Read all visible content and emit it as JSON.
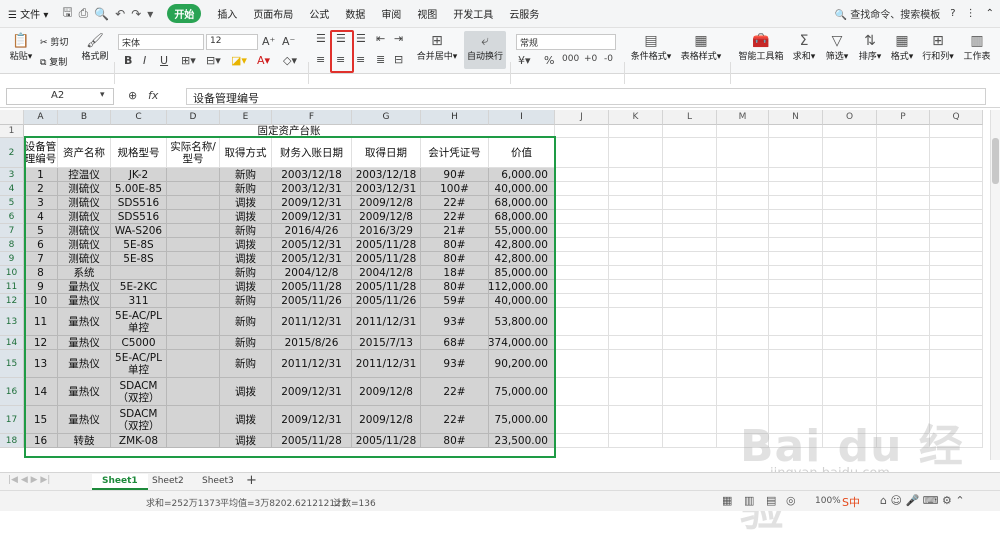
{
  "menubar": {
    "file": "文件",
    "tabs": [
      "开始",
      "插入",
      "页面布局",
      "公式",
      "数据",
      "审阅",
      "视图",
      "开发工具",
      "云服务"
    ],
    "active_tab": "开始",
    "search": "查找命令、搜索模板"
  },
  "ribbon": {
    "paste": "粘贴",
    "cut": "剪切",
    "copy": "复制",
    "format_painter": "格式刷",
    "font_name": "宋体",
    "font_size": "12",
    "merge_center": "合并居中",
    "wrap_text": "自动换行",
    "number_format": "常规",
    "conditional_format": "条件格式",
    "table_style": "表格样式",
    "smart_toolbox": "智能工具箱",
    "sum": "求和",
    "filter": "筛选",
    "sort": "排序",
    "format": "格式",
    "row_col": "行和列",
    "worksheet": "工作表"
  },
  "formula_bar": {
    "name_box": "A2",
    "fx": "fx",
    "content": "设备管理编号"
  },
  "columns": [
    "A",
    "B",
    "C",
    "D",
    "E",
    "F",
    "G",
    "H",
    "I",
    "J",
    "K",
    "L",
    "M",
    "N",
    "O",
    "P",
    "Q"
  ],
  "sheet": {
    "title": "固定资产台账",
    "headers": [
      "设备管理编号",
      "资产名称",
      "规格型号",
      "实际名称/型号",
      "取得方式",
      "财务入账日期",
      "取得日期",
      "会计凭证号",
      "价值"
    ],
    "rows": [
      [
        "1",
        "控温仪",
        "JK-2",
        "",
        "新购",
        "2003/12/18",
        "2003/12/18",
        "90#",
        "6,000.00"
      ],
      [
        "2",
        "测硫仪",
        "5.00E-85",
        "",
        "新购",
        "2003/12/31",
        "2003/12/31",
        "100#",
        "40,000.00"
      ],
      [
        "3",
        "测硫仪",
        "SDS516",
        "",
        "调拨",
        "2009/12/31",
        "2009/12/8",
        "22#",
        "68,000.00"
      ],
      [
        "4",
        "测硫仪",
        "SDS516",
        "",
        "调拨",
        "2009/12/31",
        "2009/12/8",
        "22#",
        "68,000.00"
      ],
      [
        "5",
        "测硫仪",
        "WA-S206",
        "",
        "新购",
        "2016/4/26",
        "2016/3/29",
        "21#",
        "55,000.00"
      ],
      [
        "6",
        "测硫仪",
        "5E-8S",
        "",
        "调拨",
        "2005/12/31",
        "2005/11/28",
        "80#",
        "42,800.00"
      ],
      [
        "7",
        "测硫仪",
        "5E-8S",
        "",
        "调拨",
        "2005/12/31",
        "2005/11/28",
        "80#",
        "42,800.00"
      ],
      [
        "8",
        "系统",
        "",
        "",
        "新购",
        "2004/12/8",
        "2004/12/8",
        "18#",
        "85,000.00"
      ],
      [
        "9",
        "量热仪",
        "5E-2KC",
        "",
        "调拨",
        "2005/11/28",
        "2005/11/28",
        "80#",
        "112,000.00"
      ],
      [
        "10",
        "量热仪",
        "311",
        "",
        "新购",
        "2005/11/26",
        "2005/11/26",
        "59#",
        "40,000.00"
      ],
      [
        "11",
        "量热仪",
        "5E-AC/PL单控",
        "",
        "新购",
        "2011/12/31",
        "2011/12/31",
        "93#",
        "53,800.00"
      ],
      [
        "12",
        "量热仪",
        "C5000",
        "",
        "新购",
        "2015/8/26",
        "2015/7/13",
        "68#",
        "374,000.00"
      ],
      [
        "13",
        "量热仪",
        "5E-AC/PL单控",
        "",
        "新购",
        "2011/12/31",
        "2011/12/31",
        "93#",
        "90,200.00"
      ],
      [
        "14",
        "量热仪",
        "SDACM（双控）",
        "",
        "调拨",
        "2009/12/31",
        "2009/12/8",
        "22#",
        "75,000.00"
      ],
      [
        "15",
        "量热仪",
        "SDACM（双控）",
        "",
        "调拨",
        "2009/12/31",
        "2009/12/8",
        "22#",
        "75,000.00"
      ],
      [
        "16",
        "转鼓",
        "ZMK-08",
        "",
        "调拨",
        "2005/11/28",
        "2005/11/28",
        "80#",
        "23,500.00"
      ]
    ]
  },
  "sheet_tabs": [
    "Sheet1",
    "Sheet2",
    "Sheet3"
  ],
  "active_sheet": "Sheet1",
  "status": {
    "sum": "求和=252万1373",
    "avg": "平均值=3万8202.621212121",
    "count": "计数=136",
    "zoom": "100%"
  },
  "watermark": {
    "main": "Bai du 经验",
    "sub": "jingyan.baidu.com"
  }
}
